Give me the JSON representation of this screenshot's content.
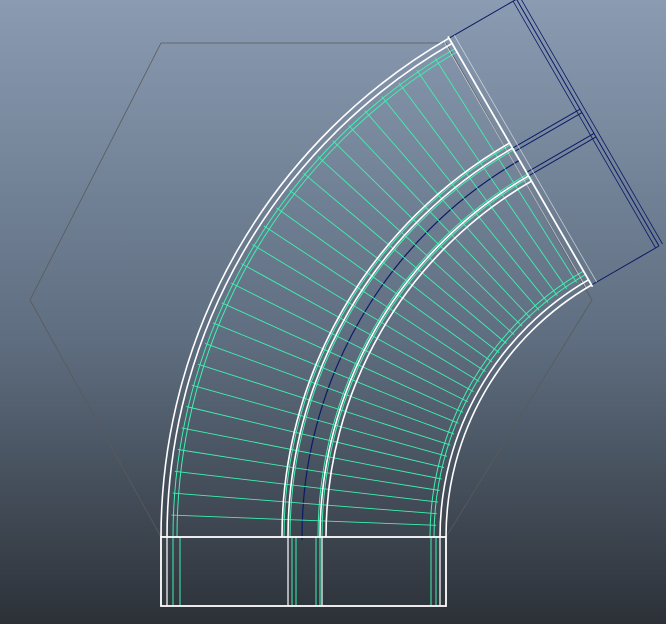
{
  "viewport": {
    "view": "top-orthographic",
    "background_gradient": {
      "top": "#8a9bb2",
      "mid": "#5e6d7f",
      "bottom": "#2c3138"
    }
  },
  "colors": {
    "selected_wireframe": "#ffffff",
    "isoparm": "#3ff0b0",
    "curve": "#0a1a66",
    "hexagon_outline": "#5a5a5a"
  },
  "mesh": {
    "object_type": "curved-pipe-sweep",
    "bend_angle_deg": 60,
    "straight_segment_present": true,
    "radial_divisions": 27
  }
}
